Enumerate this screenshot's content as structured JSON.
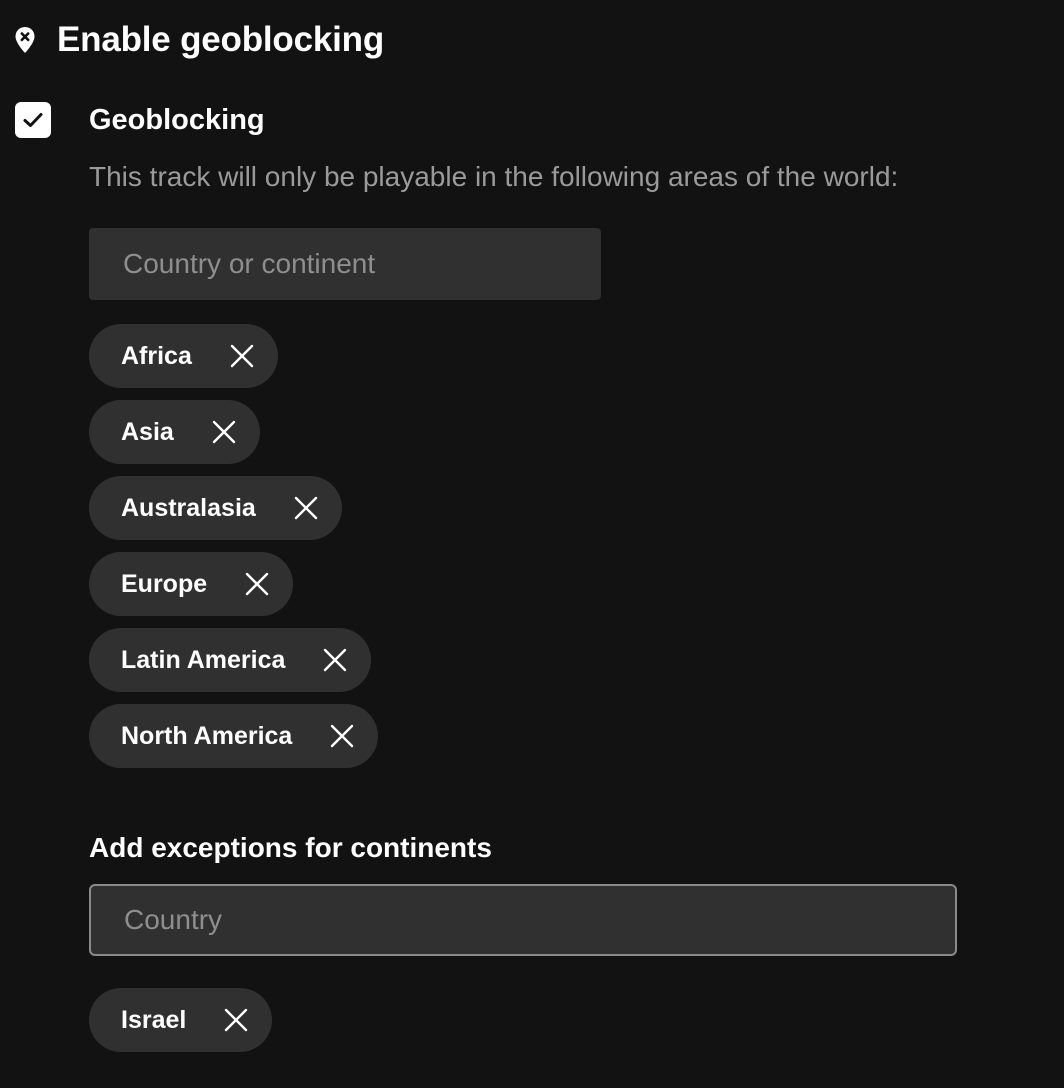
{
  "section": {
    "title": "Enable geoblocking",
    "icon": "map-pin-x-icon"
  },
  "geoblocking": {
    "checkbox_checked": true,
    "label": "Geoblocking",
    "description": "This track will only be playable in the following areas of the world:",
    "input_placeholder": "Country or continent",
    "regions": [
      {
        "label": "Africa"
      },
      {
        "label": "Asia"
      },
      {
        "label": "Australasia"
      },
      {
        "label": "Europe"
      },
      {
        "label": "Latin America"
      },
      {
        "label": "North America"
      }
    ]
  },
  "exceptions": {
    "title": "Add exceptions for continents",
    "input_placeholder": "Country",
    "countries": [
      {
        "label": "Israel"
      }
    ]
  }
}
